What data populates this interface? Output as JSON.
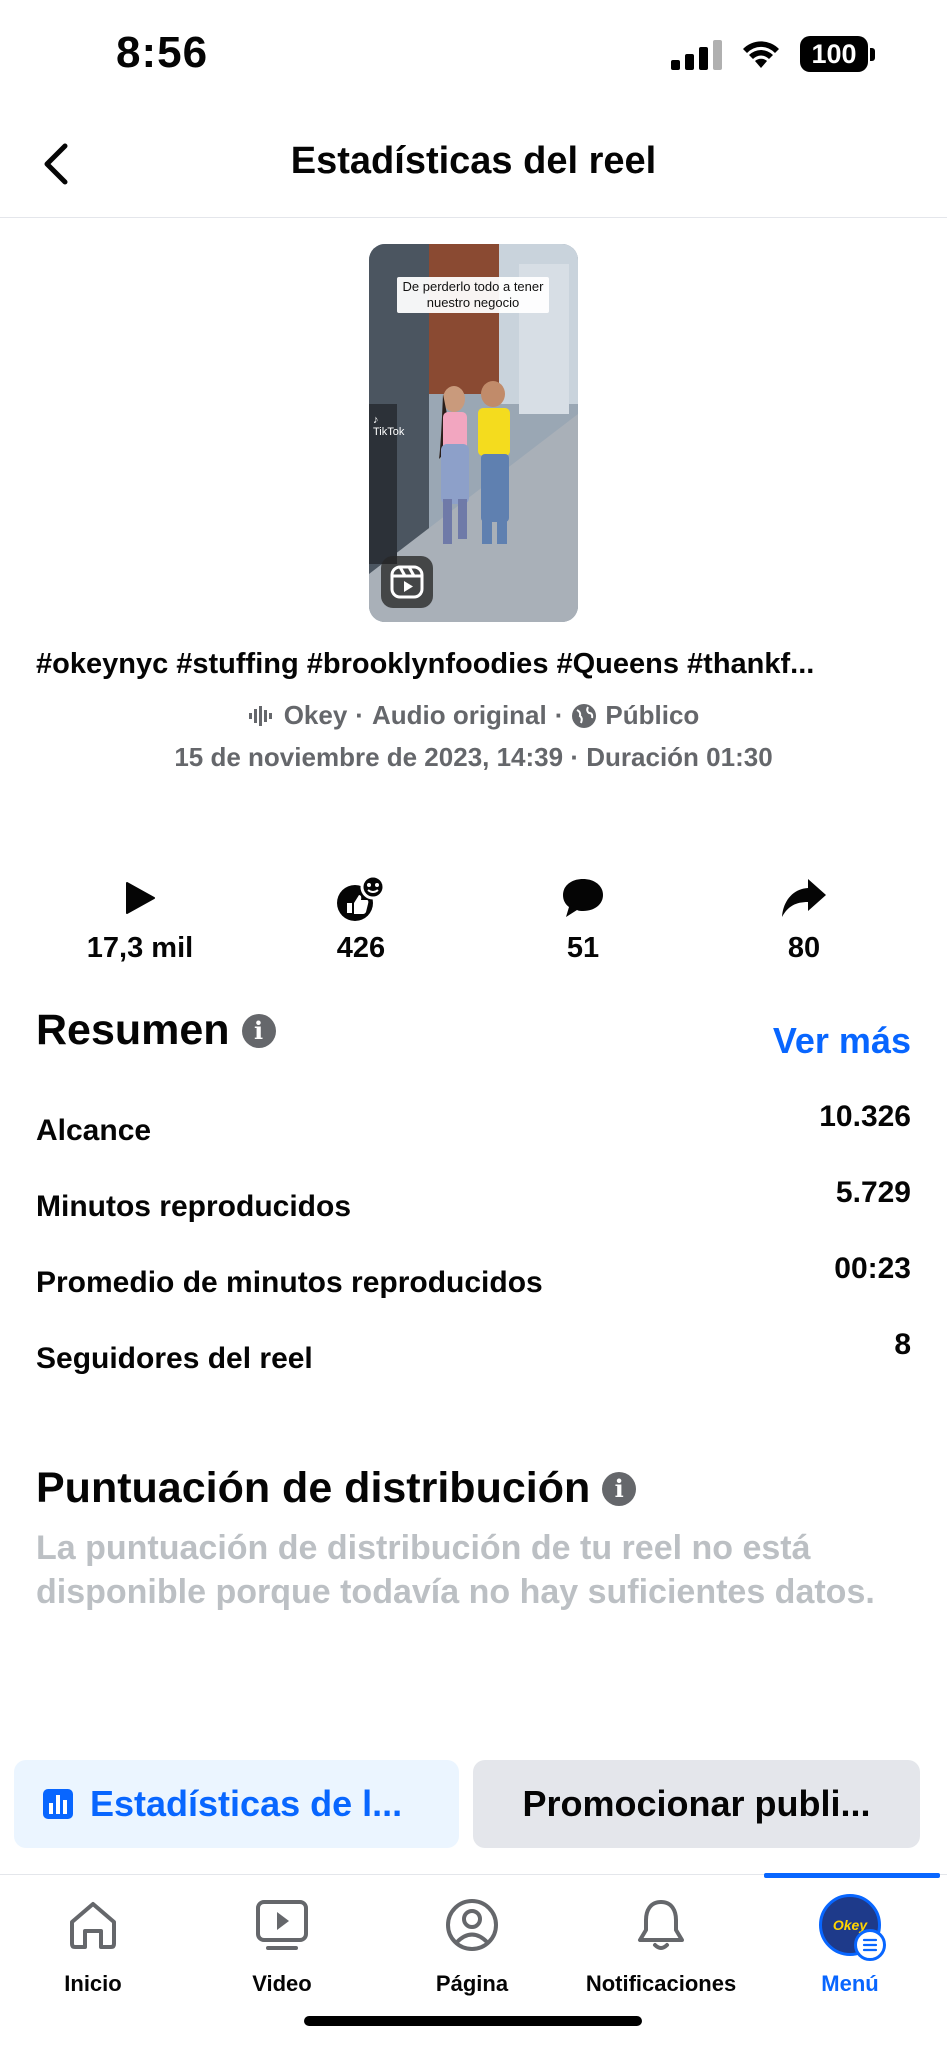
{
  "status_bar": {
    "time": "8:56",
    "battery": "100"
  },
  "header": {
    "title": "Estadísticas del reel"
  },
  "reel": {
    "thumbnail_caption": "De perderlo todo a tener nuestro negocio",
    "thumbnail_watermark": "TikTok",
    "caption": "#okeynyc #stuffing #brooklynfoodies #Queens #thankf...",
    "author": "Okey",
    "audio": "Audio original",
    "visibility": "Público",
    "date": "15 de noviembre de 2023, 14:39",
    "duration": "Duración 01:30",
    "separator": "·"
  },
  "metrics": {
    "plays": "17,3 mil",
    "reactions": "426",
    "comments": "51",
    "shares": "80"
  },
  "summary": {
    "title": "Resumen",
    "see_more": "Ver más",
    "rows": [
      {
        "label": "Alcance",
        "value": "10.326"
      },
      {
        "label": "Minutos reproducidos",
        "value": "5.729"
      },
      {
        "label": "Promedio de minutos reproducidos",
        "value": "00:23"
      },
      {
        "label": "Seguidores del reel",
        "value": "8"
      }
    ]
  },
  "distribution": {
    "title": "Puntuación de distribución",
    "description": "La puntuación de distribución de tu reel no está disponible porque todavía no hay suficientes datos."
  },
  "actions": {
    "insights_label": "Estadísticas de l...",
    "promote_label": "Promocionar publi..."
  },
  "tabs": [
    {
      "label": "Inicio",
      "icon": "home-icon"
    },
    {
      "label": "Video",
      "icon": "video-icon"
    },
    {
      "label": "Página",
      "icon": "page-icon"
    },
    {
      "label": "Notificaciones",
      "icon": "bell-icon"
    },
    {
      "label": "Menú",
      "icon": "menu-avatar",
      "active": true
    }
  ],
  "colors": {
    "accent": "#0866ff",
    "secondary_text": "#65676b",
    "disabled_text": "#bcc0c4",
    "insights_bg": "#ebf5ff",
    "promote_bg": "#e4e6eb"
  }
}
